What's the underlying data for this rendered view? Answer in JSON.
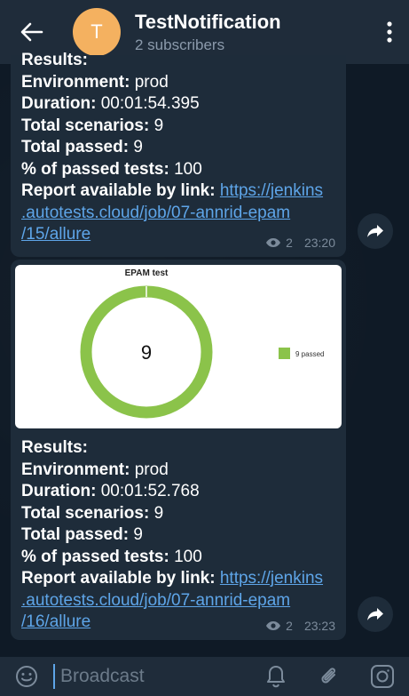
{
  "header": {
    "avatar_letter": "T",
    "title": "TestNotification",
    "subtitle": "2 subscribers"
  },
  "messages": [
    {
      "results_label": "Results:",
      "env_label": "Environment:",
      "env_value": " prod",
      "duration_label": "Duration:",
      "duration_value": " 00:01:54.395",
      "scenarios_label": "Total scenarios:",
      "scenarios_value": " 9",
      "passed_label": "Total passed:",
      "passed_value": " 9",
      "pct_label": "% of passed tests:",
      "pct_value": " 100",
      "report_label": "Report available by link:",
      "link_line1": "https://jenkins",
      "link_line2": ".autotests.cloud/job/07-annrid-epam",
      "link_line3": "/15/allure",
      "views": "2",
      "time": "23:20"
    },
    {
      "results_label": "Results:",
      "env_label": "Environment:",
      "env_value": " prod",
      "duration_label": "Duration:",
      "duration_value": " 00:01:52.768",
      "scenarios_label": "Total scenarios:",
      "scenarios_value": " 9",
      "passed_label": "Total passed:",
      "passed_value": " 9",
      "pct_label": "% of passed tests:",
      "pct_value": " 100",
      "report_label": "Report available by link:",
      "link_line1": "https://jenkins",
      "link_line2": ".autotests.cloud/job/07-annrid-epam",
      "link_line3": "/16/allure",
      "views": "2",
      "time": "23:23"
    }
  ],
  "chart_data": {
    "type": "pie",
    "title": "EPAM test",
    "center_label": "9",
    "categories": [
      "9 passed"
    ],
    "values": [
      9
    ],
    "colors": [
      "#8bc34a"
    ]
  },
  "composer": {
    "placeholder": "Broadcast"
  },
  "colors": {
    "header_bg": "#1f2c3a",
    "bubble_bg": "#1e2c3a",
    "link": "#5ea5e8",
    "avatar": "#f4b160",
    "donut": "#8bc34a"
  },
  "icons": [
    "back-arrow-icon",
    "more-vert-icon",
    "share-icon",
    "eye-icon",
    "emoji-icon",
    "bell-icon",
    "paperclip-icon",
    "camera-icon"
  ]
}
